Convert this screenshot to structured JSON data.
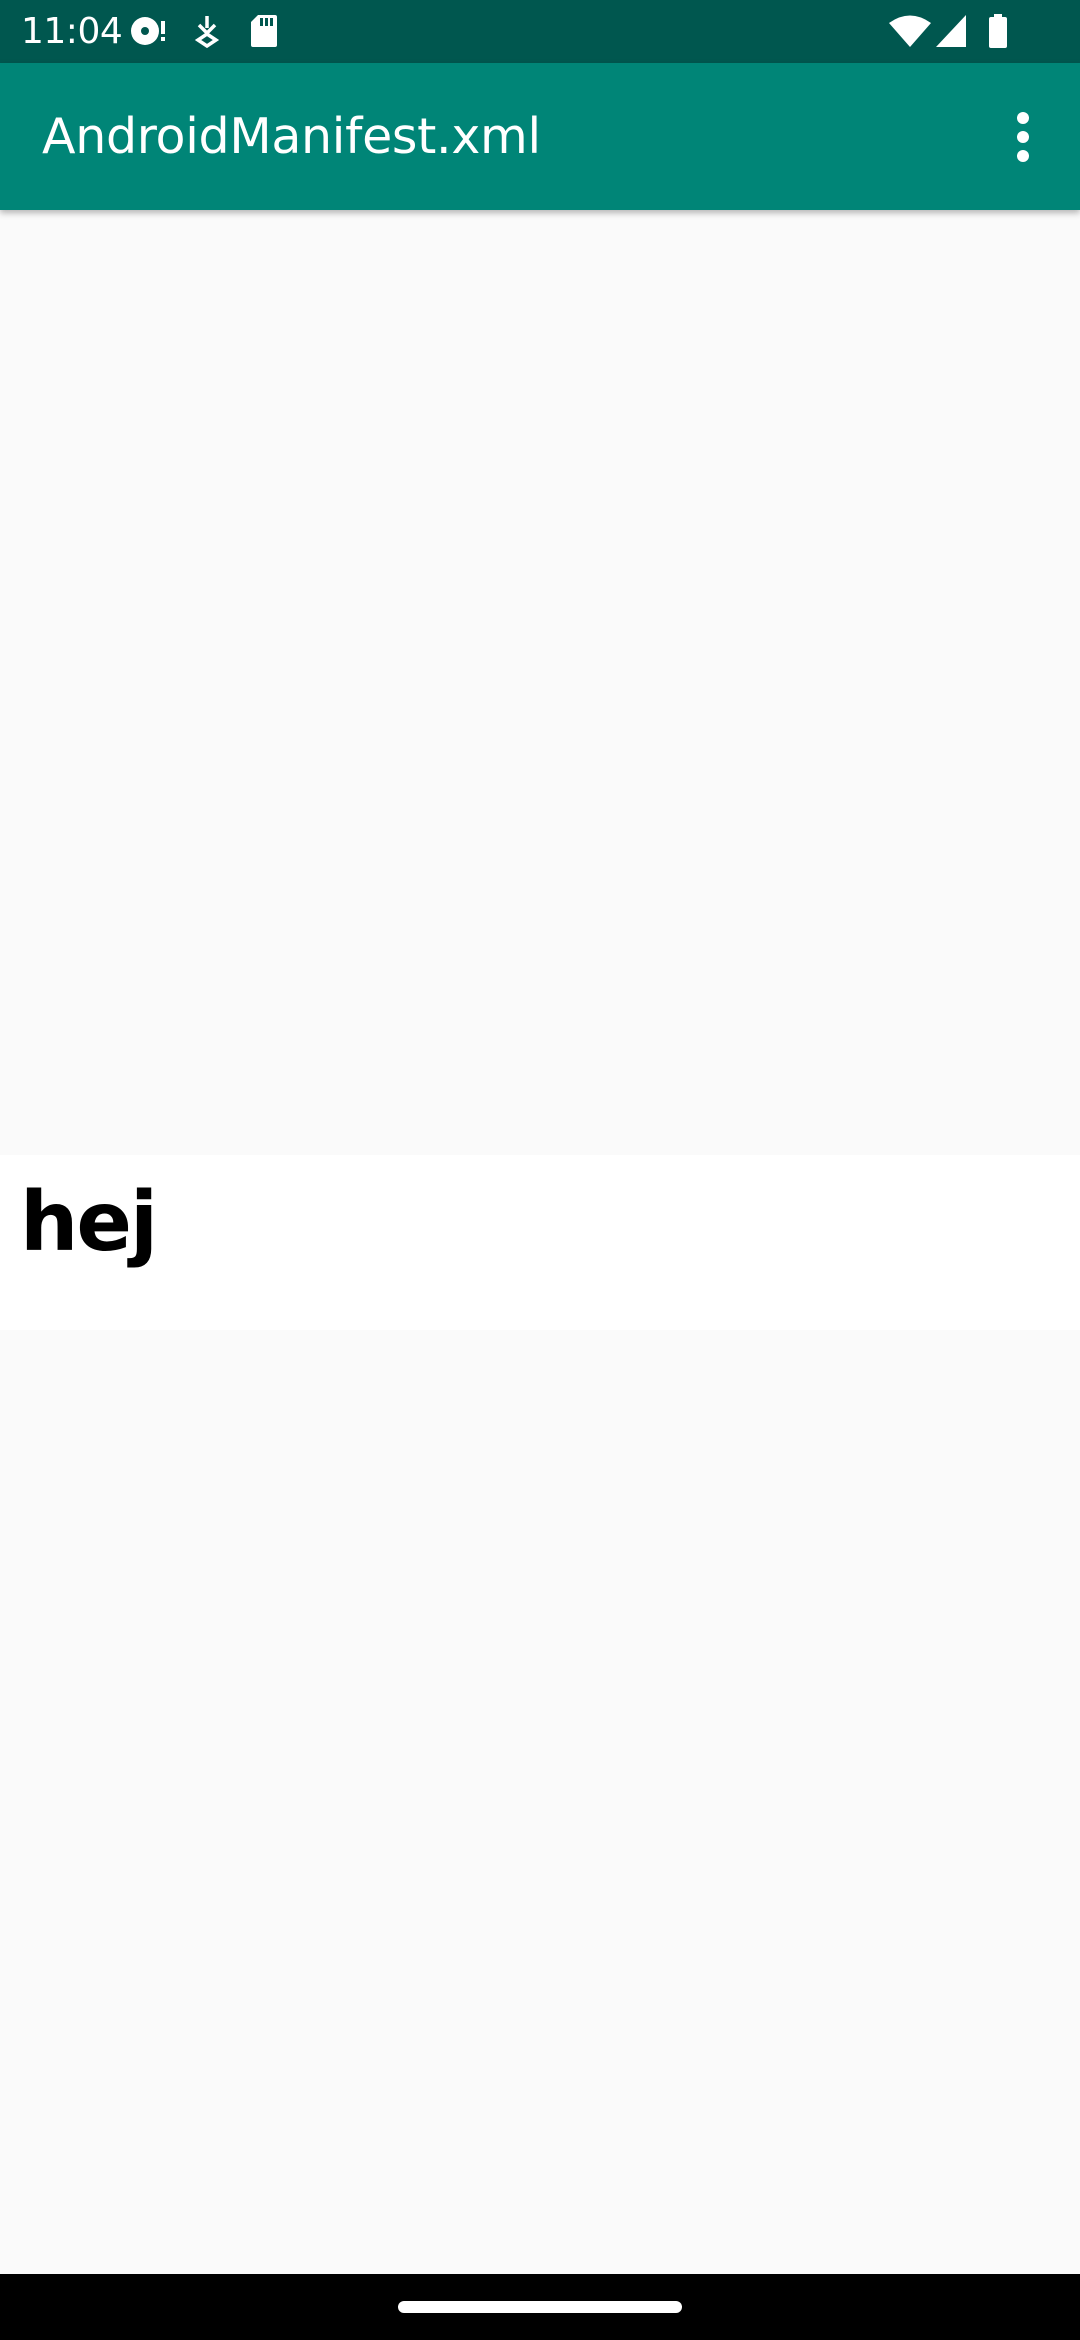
{
  "status_bar": {
    "time": "11:04",
    "icons_left": [
      "media-notification-icon",
      "download-notification-icon",
      "sd-card-icon"
    ],
    "icons_right": [
      "wifi-icon",
      "cellular-signal-icon",
      "battery-icon"
    ],
    "background_color": "#00574f"
  },
  "app_bar": {
    "title": "AndroidManifest.xml",
    "menu_icon": "more-vert-icon",
    "background_color": "#008577"
  },
  "content": {
    "text": "hej",
    "background_color": "#fafafa",
    "card_color": "#ffffff"
  },
  "nav_bar": {
    "handle": "home-gesture-handle"
  }
}
